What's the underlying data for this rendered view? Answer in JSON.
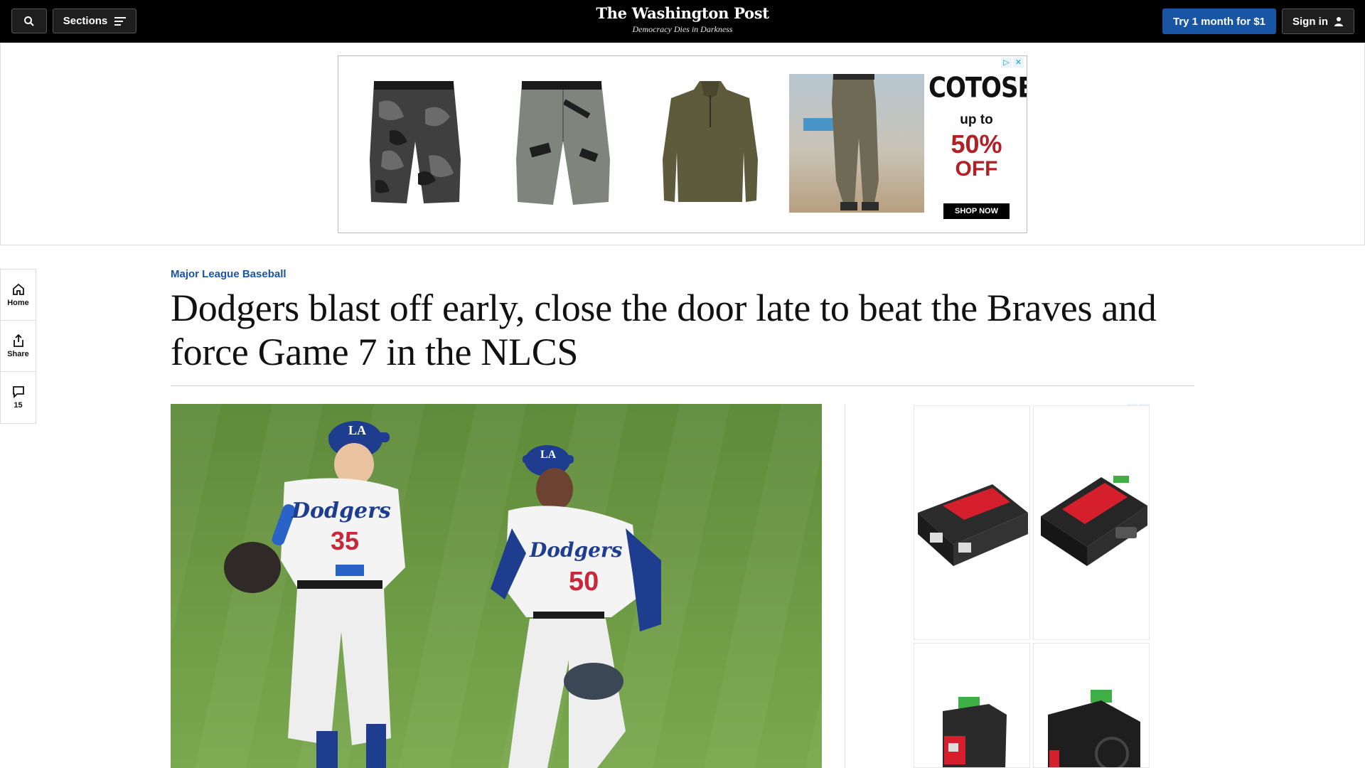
{
  "header": {
    "search_icon": "search-icon",
    "sections_label": "Sections",
    "brand_name": "The Washington Post",
    "tagline": "Democracy Dies in Darkness",
    "try_label": "Try 1 month for $1",
    "signin_label": "Sign in"
  },
  "top_ad": {
    "brand": "COTOSEN",
    "line1": "up to",
    "line2": "50%",
    "line3": "OFF",
    "cta": "SHOP NOW",
    "colors": {
      "accent": "#b21f24"
    }
  },
  "rail": {
    "home_label": "Home",
    "share_label": "Share",
    "comments_count": "15"
  },
  "article": {
    "kicker": "Major League Baseball",
    "headline": "Dodgers blast off early, close the door late to beat the Braves and force Game 7 in the NLCS",
    "photo": {
      "team_word": "Dodgers",
      "player1_number": "35",
      "player2_number": "50",
      "cap_logo": "LA"
    }
  },
  "colors": {
    "topbar": "#000000",
    "accent_blue": "#1955a5",
    "field_green": "#6f9a45"
  }
}
